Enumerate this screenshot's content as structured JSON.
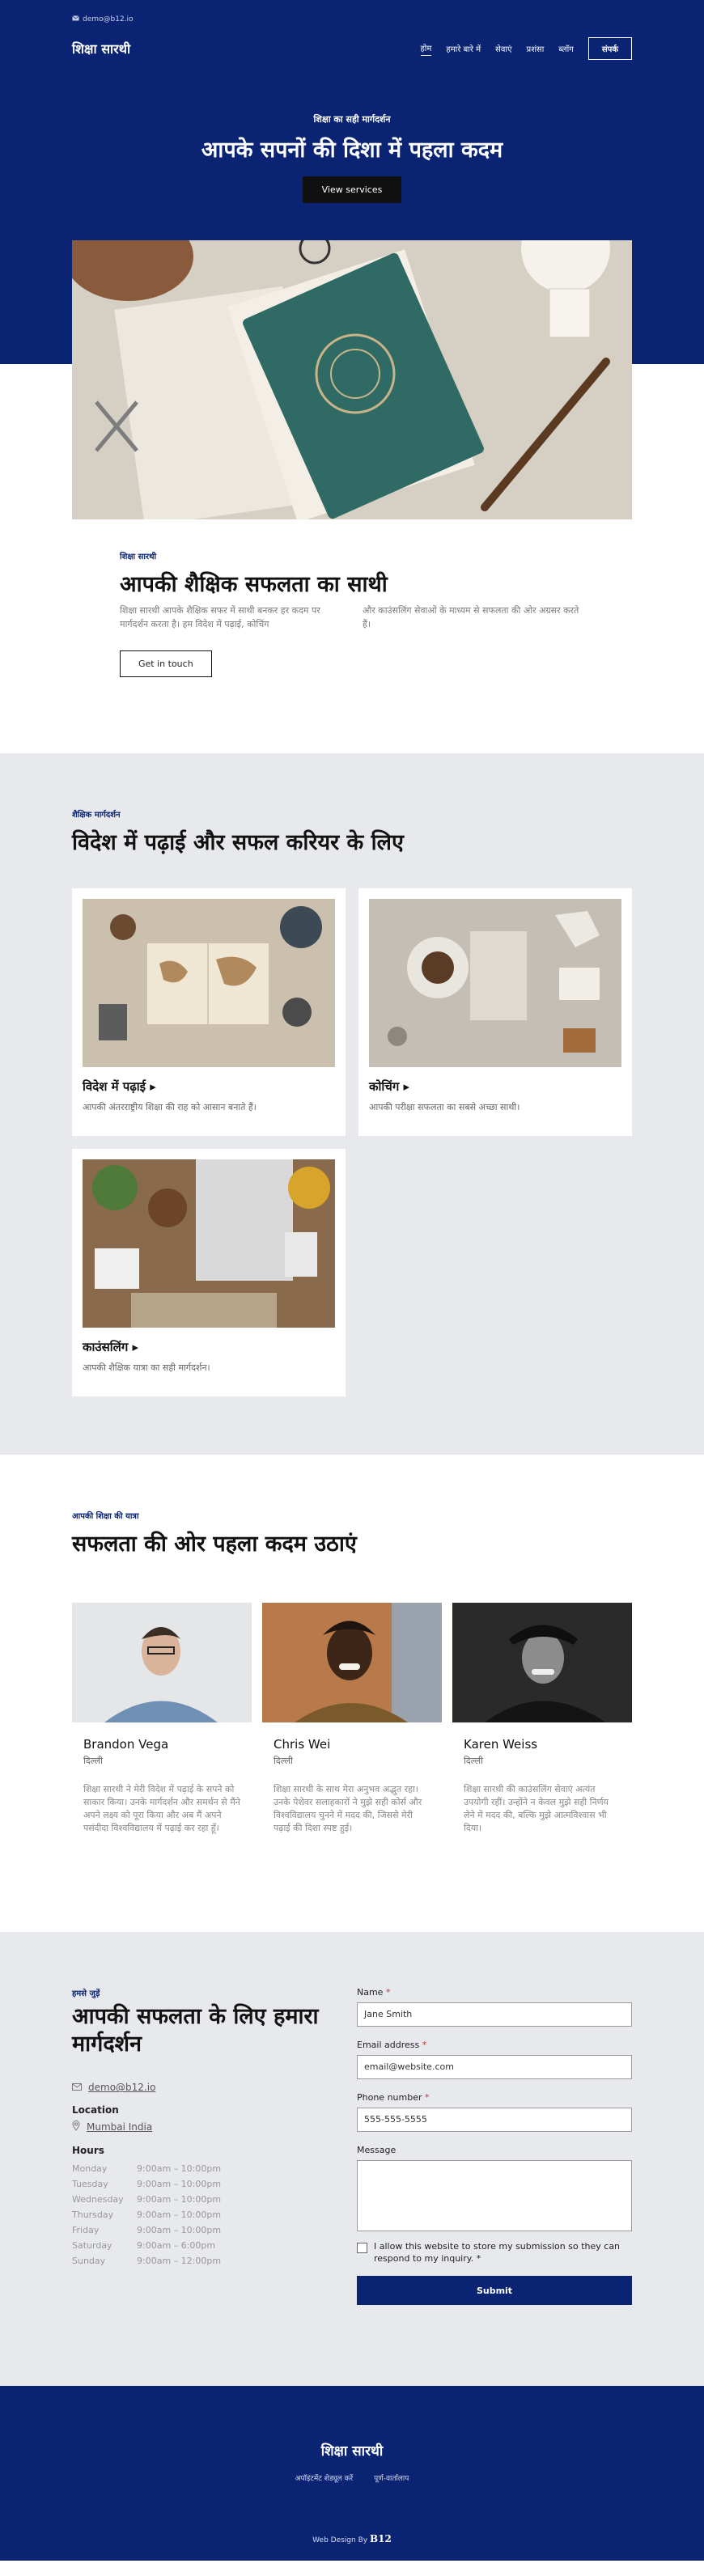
{
  "topbar": {
    "email": "demo@b12.io"
  },
  "nav": {
    "brand": "शिक्षा सारथी",
    "links": [
      "होम",
      "हमारे बारे में",
      "सेवाएं",
      "प्रशंसा",
      "ब्लॉग"
    ],
    "cta": "संपर्क"
  },
  "hero": {
    "eyebrow": "शिक्षा का सही मार्गदर्शन",
    "title": "आपके सपनों की दिशा में पहला कदम",
    "button": "View services"
  },
  "about": {
    "eyebrow": "शिक्षा सारथी",
    "title": "आपकी शैक्षिक सफलता का साथी",
    "col1": "शिक्षा सारथी आपके शैक्षिक सफर में साथी बनकर हर कदम पर मार्गदर्शन करता है। हम विदेश में पढ़ाई, कोचिंग",
    "col2": "और काउंसलिंग सेवाओं के माध्यम से सफलता की ओर अग्रसर करते हैं।",
    "button": "Get in touch"
  },
  "services": {
    "eyebrow": "शैक्षिक मार्गदर्शन",
    "title": "विदेश में पढ़ाई और सफल करियर के लिए",
    "items": [
      {
        "title": "विदेश में पढ़ाई",
        "desc": "आपकी अंतरराष्ट्रीय शिक्षा की राह को आसान बनाते हैं।"
      },
      {
        "title": "कोचिंग",
        "desc": "आपकी परीक्षा सफलता का सबसे अच्छा साथी।"
      },
      {
        "title": "काउंसलिंग",
        "desc": "आपकी शैक्षिक यात्रा का सही मार्गदर्शन।"
      }
    ]
  },
  "testimonials": {
    "eyebrow": "आपकी शिक्षा की यात्रा",
    "title": "सफलता की ओर पहला कदम उठाएं",
    "items": [
      {
        "name": "Brandon Vega",
        "location": "दिल्ली",
        "text": "शिक्षा सारथी ने मेरी विदेश में पढ़ाई के सपने को साकार किया। उनके मार्गदर्शन और समर्थन से मैंने अपने लक्ष्य को पूरा किया और अब मैं अपने पसंदीदा विश्वविद्यालय में पढ़ाई कर रहा हूँ।"
      },
      {
        "name": "Chris Wei",
        "location": "दिल्ली",
        "text": "शिक्षा सारथी के साथ मेरा अनुभव अद्भुत रहा। उनके पेशेवर सलाहकारों ने मुझे सही कोर्स और विश्वविद्यालय चुनने में मदद की, जिससे मेरी पढ़ाई की दिशा स्पष्ट हुई।"
      },
      {
        "name": "Karen Weiss",
        "location": "दिल्ली",
        "text": "शिक्षा सारथी की काउंसलिंग सेवाएं अत्यंत उपयोगी रहीं। उन्होंने न केवल मुझे सही निर्णय लेने में मदद की, बल्कि मुझे आत्मविश्वास भी दिया।"
      }
    ]
  },
  "contact": {
    "eyebrow": "हमसे जुड़ें",
    "title": "आपकी सफलता के लिए हमारा मार्गदर्शन",
    "email": "demo@b12.io",
    "location_label": "Location",
    "location": "Mumbai India",
    "hours_label": "Hours",
    "hours": [
      {
        "day": "Monday",
        "time": "9:00am  –  10:00pm"
      },
      {
        "day": "Tuesday",
        "time": "9:00am  –  10:00pm"
      },
      {
        "day": "Wednesday",
        "time": "9:00am  –  10:00pm"
      },
      {
        "day": "Thursday",
        "time": "9:00am  –  10:00pm"
      },
      {
        "day": "Friday",
        "time": "9:00am  –  10:00pm"
      },
      {
        "day": "Saturday",
        "time": "9:00am  –  6:00pm"
      },
      {
        "day": "Sunday",
        "time": "9:00am  –  12:00pm"
      }
    ],
    "form": {
      "name_label": "Name",
      "name_placeholder": "Jane Smith",
      "email_label": "Email address",
      "email_placeholder": "email@website.com",
      "phone_label": "Phone number",
      "phone_placeholder": "555-555-5555",
      "message_label": "Message",
      "consent": "I allow this website to store my submission so they can respond to my inquiry.",
      "submit": "Submit"
    }
  },
  "footer": {
    "brand": "शिक्षा सारथी",
    "links": [
      "अपॉइंटमेंट शेड्यूल करें",
      "पूर्ण-वार्तालाप"
    ],
    "credit": "Web Design By",
    "credit_logo": "B12"
  },
  "colors": {
    "brand": "#0a2473",
    "section_bg": "#e8e9ec",
    "required": "#c0392b"
  }
}
